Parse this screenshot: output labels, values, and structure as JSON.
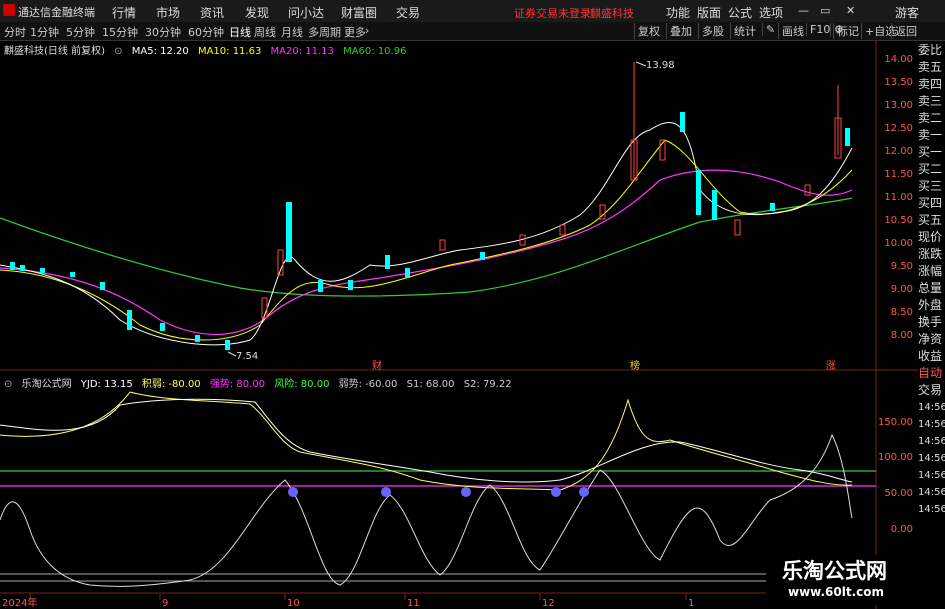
{
  "menubar": {
    "app_title": "通达信金融终端",
    "items": [
      "行情",
      "市场",
      "资讯",
      "发现",
      "问小达",
      "财富圈",
      "交易"
    ],
    "notice": "证券交易未登录",
    "stock_name": "麒盛科技",
    "right_items": [
      "功能",
      "版面",
      "公式",
      "选项"
    ],
    "guest": "游客"
  },
  "toolbar": {
    "periods": [
      "分时",
      "1分钟",
      "5分钟",
      "15分钟",
      "30分钟",
      "60分钟",
      "日线",
      "周线",
      "月线",
      "多周期",
      "更多"
    ],
    "active": "日线",
    "right": [
      "复权",
      "叠加",
      "多股",
      "统计",
      "画线",
      "F10",
      "标记",
      "+自选",
      "返回"
    ]
  },
  "main_chart": {
    "title": "麒盛科技(日线 前复权)",
    "ma": [
      {
        "label": "MA5: 12.20",
        "color": "#ffffff"
      },
      {
        "label": "MA10: 11.63",
        "color": "#ffff00"
      },
      {
        "label": "MA20: 11.13",
        "color": "#ff33ff"
      },
      {
        "label": "MA60: 10.96",
        "color": "#33cc33"
      }
    ],
    "price_axis": [
      "14.00",
      "13.50",
      "13.00",
      "12.50",
      "12.00",
      "11.50",
      "11.00",
      "10.50",
      "10.00",
      "9.50",
      "9.00",
      "8.50",
      "8.00"
    ],
    "high_marker": "13.98",
    "low_marker": "7.54",
    "event_labels": [
      "财",
      "榜",
      "涨"
    ]
  },
  "indicator": {
    "title": "乐淘公式网",
    "values": [
      {
        "label": "YJD: 13.15",
        "color": "#ffffff"
      },
      {
        "label": "积弱: -80.00",
        "color": "#ffff66"
      },
      {
        "label": "强势: 80.00",
        "color": "#ff33ff"
      },
      {
        "label": "风险: 80.00",
        "color": "#33ff33"
      },
      {
        "label": "弱势: -60.00",
        "color": "#cccccc"
      },
      {
        "label": "S1: 68.00",
        "color": "#cccccc"
      },
      {
        "label": "S2: 79.22",
        "color": "#cccccc"
      }
    ],
    "axis": [
      "150.00",
      "100.00",
      "50.00",
      "0.00"
    ]
  },
  "time_axis": [
    "2024年",
    "9",
    "10",
    "11",
    "12",
    "1"
  ],
  "side_panel": [
    "委比",
    "卖五",
    "卖四",
    "卖三",
    "卖二",
    "卖一",
    "买一",
    "买二",
    "买三",
    "买四",
    "买五",
    "现价",
    "涨跌",
    "涨幅",
    "总量",
    "外盘",
    "换手",
    "净资",
    "收益",
    "自动",
    "交易",
    "14:56",
    "14:56",
    "14:56",
    "14:56",
    "14:56",
    "14:56",
    "14:56"
  ],
  "watermark": {
    "line1": "乐淘公式网",
    "line2": "www.60lt.com"
  }
}
